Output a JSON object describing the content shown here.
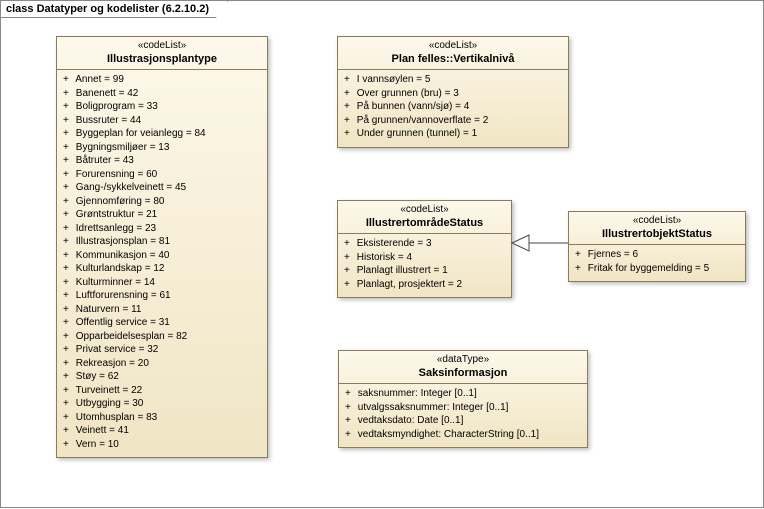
{
  "diagram": {
    "keyword": "class",
    "title": "Datatyper og kodelister (6.2.10.2)"
  },
  "boxes": {
    "illu": {
      "stereo": "«codeList»",
      "name": "Illustrasjonsplantype",
      "attrs": [
        "Annet = 99",
        "Banenett = 42",
        "Boligprogram = 33",
        "Bussruter = 44",
        "Byggeplan for veianlegg = 84",
        "Bygningsmiljøer = 13",
        "Båtruter = 43",
        "Forurensning = 60",
        "Gang-/sykkelveinett = 45",
        "Gjennomføring = 80",
        "Grøntstruktur = 21",
        "Idrettsanlegg = 23",
        "Illustrasjonsplan = 81",
        "Kommunikasjon = 40",
        "Kulturlandskap = 12",
        "Kulturminner = 14",
        "Luftforurensning = 61",
        "Naturvern = 11",
        "Offentlig service = 31",
        "Opparbeidelsesplan = 82",
        "Privat service = 32",
        "Rekreasjon = 20",
        "Støy = 62",
        "Turveinett = 22",
        "Utbygging = 30",
        "Utomhusplan = 83",
        "Veinett = 41",
        "Vern = 10"
      ]
    },
    "vert": {
      "stereo": "«codeList»",
      "name": "Plan felles::Vertikalnivå",
      "attrs": [
        "I vannsøylen = 5",
        "Over grunnen (bru) = 3",
        "På bunnen (vann/sjø) = 4",
        "På grunnen/vannoverflate = 2",
        "Under grunnen (tunnel) = 1"
      ]
    },
    "omrade": {
      "stereo": "«codeList»",
      "name": "IllustrertområdeStatus",
      "attrs": [
        "Eksisterende = 3",
        "Historisk = 4",
        "Planlagt illustrert = 1",
        "Planlagt, prosjektert = 2"
      ]
    },
    "objekt": {
      "stereo": "«codeList»",
      "name": "IllustrertobjektStatus",
      "attrs": [
        "Fjernes = 6",
        "Fritak for byggemelding = 5"
      ]
    },
    "saks": {
      "stereo": "«dataType»",
      "name": "Saksinformasjon",
      "attrs": [
        "saksnummer: Integer [0..1]",
        "utvalgssaksnummer: Integer [0..1]",
        "vedtaksdato: Date [0..1]",
        "vedtaksmyndighet: CharacterString [0..1]"
      ]
    }
  }
}
